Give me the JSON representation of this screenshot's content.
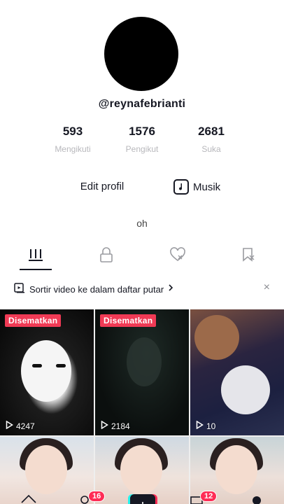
{
  "profile": {
    "username": "@reynafebrianti",
    "bio": "oh"
  },
  "stats": [
    {
      "value": "593",
      "label": "Mengikuti"
    },
    {
      "value": "1576",
      "label": "Pengikut"
    },
    {
      "value": "2681",
      "label": "Suka"
    }
  ],
  "actions": {
    "edit_label": "Edit profil",
    "music_label": "Musik"
  },
  "tabs": [
    {
      "icon": "grid-bars-icon",
      "active": true
    },
    {
      "icon": "lock-icon",
      "active": false
    },
    {
      "icon": "liked-heart-icon",
      "active": false
    },
    {
      "icon": "saved-bookmark-icon",
      "active": false
    }
  ],
  "playlist_prompt": {
    "text": "Sortir video ke dalam daftar putar",
    "close": "×"
  },
  "videos": [
    {
      "pinned_label": "Disematkan",
      "views": "4247"
    },
    {
      "pinned_label": "Disematkan",
      "views": "2184"
    },
    {
      "pinned_label": "",
      "views": "10"
    },
    {
      "pinned_label": "",
      "views": ""
    },
    {
      "pinned_label": "",
      "views": ""
    },
    {
      "pinned_label": "",
      "views": ""
    }
  ],
  "bottom_nav": {
    "friends_badge": "16",
    "inbox_badge": "12"
  },
  "colors": {
    "accent": "#fe2c55",
    "text": "#161823",
    "muted": "#b8b8bc"
  }
}
